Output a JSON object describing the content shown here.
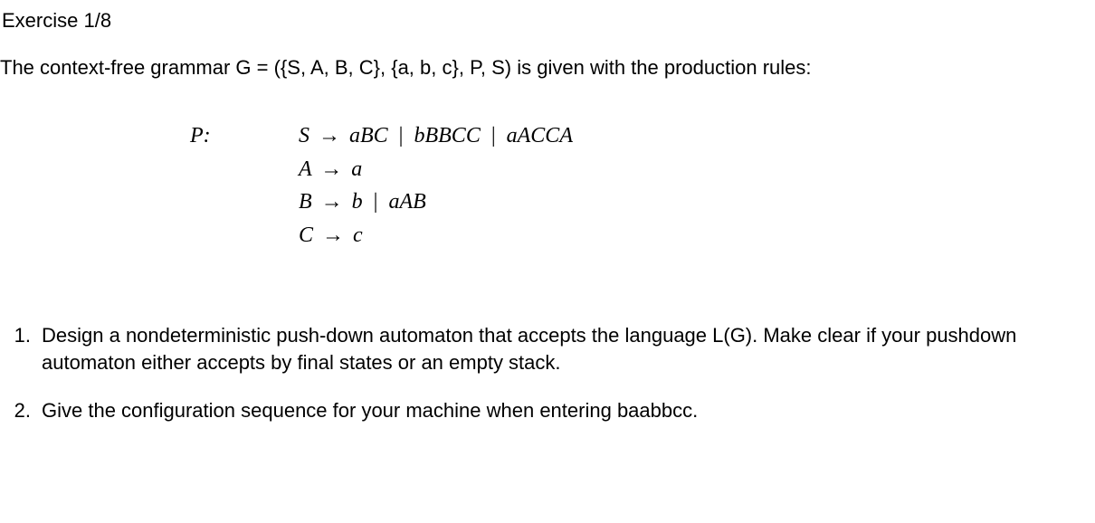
{
  "title": "Exercise 1/8",
  "intro": "The context-free grammar G = ({S, A, B, C}, {a, b, c}, P, S) is given with the production rules:",
  "rulesLabel": "P:",
  "rules": {
    "s_lhs": "S",
    "s_rhs1": "aBC",
    "s_rhs2": "bBBCC",
    "s_rhs3": "aACCA",
    "a_lhs": "A",
    "a_rhs": "a",
    "b_lhs": "B",
    "b_rhs1": "b",
    "b_rhs2": "aAB",
    "c_lhs": "C",
    "c_rhs": "c"
  },
  "questions": [
    {
      "num": "1.",
      "text": "Design a nondeterministic push-down automaton that accepts the language L(G). Make clear if your pushdown automaton either accepts by final states or an empty stack."
    },
    {
      "num": "2.",
      "text": "Give the configuration sequence for your machine when entering baabbcc."
    }
  ]
}
